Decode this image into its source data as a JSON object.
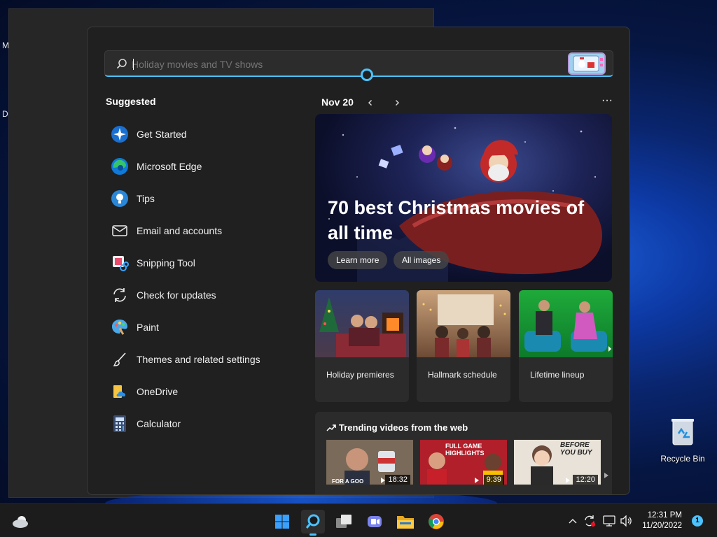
{
  "desktop": {
    "edge_labels": [
      "M",
      "D"
    ],
    "recycle_bin": {
      "label": "Recycle Bin",
      "icon": "recycle-bin-icon"
    }
  },
  "search": {
    "value": "",
    "placeholder": "Holiday movies and TV shows",
    "accent": "#4cc2ff"
  },
  "suggested": {
    "title": "Suggested",
    "items": [
      {
        "label": "Get Started",
        "icon": "get-started-icon"
      },
      {
        "label": "Microsoft Edge",
        "icon": "edge-icon"
      },
      {
        "label": "Tips",
        "icon": "tips-icon"
      },
      {
        "label": "Email and accounts",
        "icon": "mail-icon"
      },
      {
        "label": "Snipping Tool",
        "icon": "snipping-tool-icon"
      },
      {
        "label": "Check for updates",
        "icon": "update-icon"
      },
      {
        "label": "Paint",
        "icon": "paint-icon"
      },
      {
        "label": "Themes and related settings",
        "icon": "brush-icon"
      },
      {
        "label": "OneDrive",
        "icon": "onedrive-icon"
      },
      {
        "label": "Calculator",
        "icon": "calculator-icon"
      }
    ]
  },
  "highlights": {
    "date": "Nov 20",
    "more_label": "···",
    "hero": {
      "headline": "70 best Christmas movies of all time",
      "learn_more": "Learn more",
      "all_images": "All images"
    },
    "cards": [
      {
        "caption": "Holiday premieres"
      },
      {
        "caption": "Hallmark schedule"
      },
      {
        "caption": "Lifetime lineup"
      }
    ],
    "trending": {
      "title": "Trending videos from the web",
      "videos": [
        {
          "duration": "18:32",
          "overlay": "FOR A GOO"
        },
        {
          "duration": "9:39",
          "overlay": "FULL GAME HIGHLIGHTS"
        },
        {
          "duration": "12:20",
          "overlay": "BEFORE YOU BUY"
        }
      ]
    }
  },
  "taskbar": {
    "pinned": [
      "start-icon",
      "search-icon",
      "task-view-icon",
      "teams-chat-icon",
      "file-explorer-icon",
      "chrome-icon"
    ],
    "clock": {
      "time": "12:31 PM",
      "date": "11/20/2022"
    },
    "notification_count": "1"
  }
}
